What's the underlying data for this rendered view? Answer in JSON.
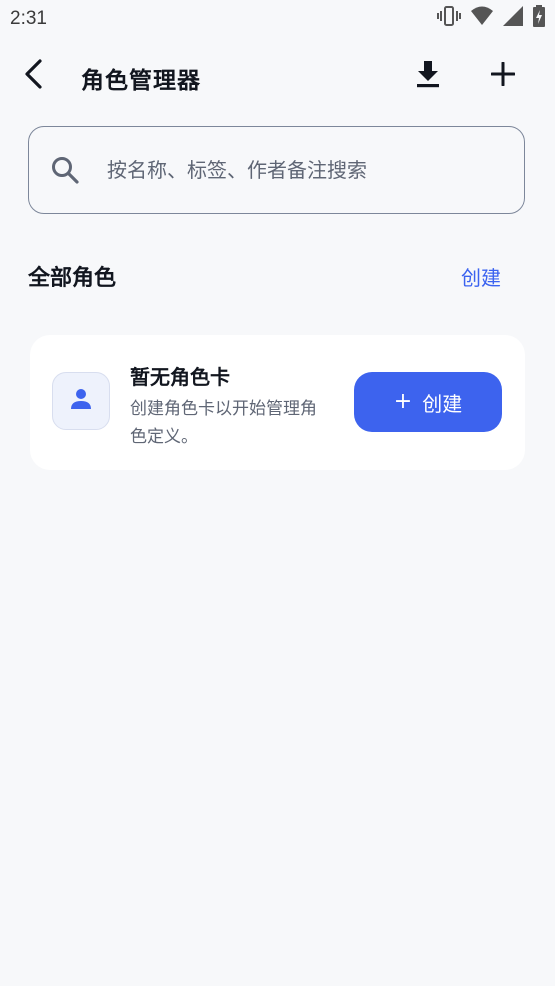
{
  "status_bar": {
    "time": "2:31",
    "icons": [
      "vibrate-icon",
      "wifi-icon",
      "signal-icon",
      "battery-charging-icon"
    ]
  },
  "app_bar": {
    "title": "角色管理器",
    "back_icon": "back-arrow-icon",
    "download_icon": "download-icon",
    "add_icon": "plus-icon"
  },
  "search": {
    "placeholder": "按名称、标签、作者备注搜索",
    "value": ""
  },
  "section": {
    "title": "全部角色",
    "create_link": "创建"
  },
  "empty_state": {
    "title": "暂无角色卡",
    "description": "创建角色卡以开始管理角色定义。",
    "button_label": "创建",
    "button_icon": "+"
  },
  "colors": {
    "accent": "#3d63ee",
    "background": "#f7f8fa",
    "card": "#ffffff"
  }
}
